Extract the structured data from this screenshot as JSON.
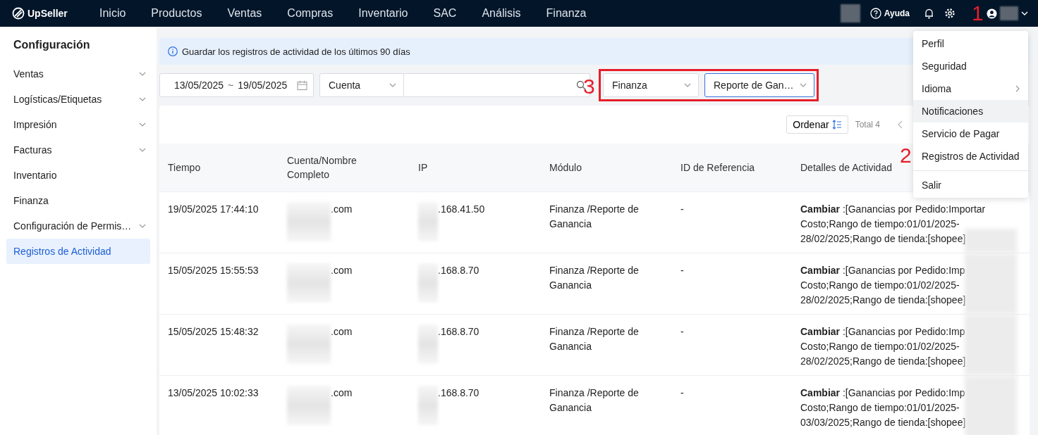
{
  "topbar": {
    "logo": "UpSeller",
    "nav": [
      {
        "label": "Inicio"
      },
      {
        "label": "Productos"
      },
      {
        "label": "Ventas"
      },
      {
        "label": "Compras"
      },
      {
        "label": "Inventario"
      },
      {
        "label": "SAC"
      },
      {
        "label": "Análisis"
      },
      {
        "label": "Finanza"
      }
    ],
    "help": "Ayuda"
  },
  "sidebar": {
    "title": "Configuración",
    "items": [
      {
        "label": "Ventas",
        "expandable": true,
        "selected": false
      },
      {
        "label": "Logísticas/Etiquetas",
        "expandable": true,
        "selected": false
      },
      {
        "label": "Impresión",
        "expandable": true,
        "selected": false
      },
      {
        "label": "Facturas",
        "expandable": true,
        "selected": false
      },
      {
        "label": "Inventario",
        "expandable": false,
        "selected": false
      },
      {
        "label": "Finanza",
        "expandable": false,
        "selected": false
      },
      {
        "label": "Configuración de Permis…",
        "expandable": true,
        "selected": false
      },
      {
        "label": "Registros de Actividad",
        "expandable": false,
        "selected": true
      }
    ]
  },
  "notice": "Guardar los registros de actividad de los últimos 90 días",
  "filters": {
    "date_from": "13/05/2025",
    "date_sep": "~",
    "date_to": "19/05/2025",
    "account_type": "Cuenta",
    "module": "Finanza",
    "submodule": "Reporte de Gan…"
  },
  "toolbar": {
    "sort": "Ordenar",
    "total": "Total 4"
  },
  "table": {
    "columns": [
      "Tiempo",
      "Cuenta/Nombre Completo",
      "IP",
      "Módulo",
      "ID de Referencia",
      "Detalles de Actividad"
    ],
    "rows": [
      {
        "time": "19/05/2025 17:44:10",
        "account": ".com",
        "ip": ".168.41.50",
        "module": "Finanza /Reporte de Ganancia",
        "reference": "-",
        "detail": "**Cambiar** :[Ganancias por Pedido:Importar Costo;Rango de tiempo:01/01/2025-28/02/2025;Rango de tienda:[shopee]"
      },
      {
        "time": "15/05/2025 15:55:53",
        "account": ".com",
        "ip": ".168.8.70",
        "module": "Finanza /Reporte de Ganancia",
        "reference": "-",
        "detail": "**Cambiar** :[Ganancias por Pedido:Imp Costo;Rango de tiempo:01/02/2025-28/02/2025;Rango de tienda:[shopee]"
      },
      {
        "time": "15/05/2025 15:48:32",
        "account": ".com",
        "ip": ".168.8.70",
        "module": "Finanza /Reporte de Ganancia",
        "reference": "-",
        "detail": "**Cambiar** :[Ganancias por Pedido:Imp Costo;Rango de tiempo:01/02/2025-28/02/2025;Rango de tienda:[shopee]"
      },
      {
        "time": "13/05/2025 10:02:33",
        "account": ".com",
        "ip": ".168.8.70",
        "module": "Finanza /Reporte de Ganancia",
        "reference": "-",
        "detail": "**Cambiar** :[Ganancias por Pedido:Imp Costo;Rango de tiempo:01/01/2025-03/03/2025;Rango de tienda:[shopee]"
      }
    ]
  },
  "user_menu": {
    "items": [
      {
        "label": "Perfil",
        "submenu": false,
        "highlighted": false
      },
      {
        "label": "Seguridad",
        "submenu": false,
        "highlighted": false
      },
      {
        "label": "Idioma",
        "submenu": true,
        "highlighted": false
      },
      {
        "label": "Notificaciones",
        "submenu": false,
        "highlighted": true
      },
      {
        "label": "Servicio de Pagar",
        "submenu": false,
        "highlighted": false
      },
      {
        "label": "Registros de Actividad",
        "submenu": false,
        "highlighted": false
      }
    ],
    "footer_item": "Salir"
  },
  "annotations": [
    "1",
    "2",
    "3"
  ]
}
